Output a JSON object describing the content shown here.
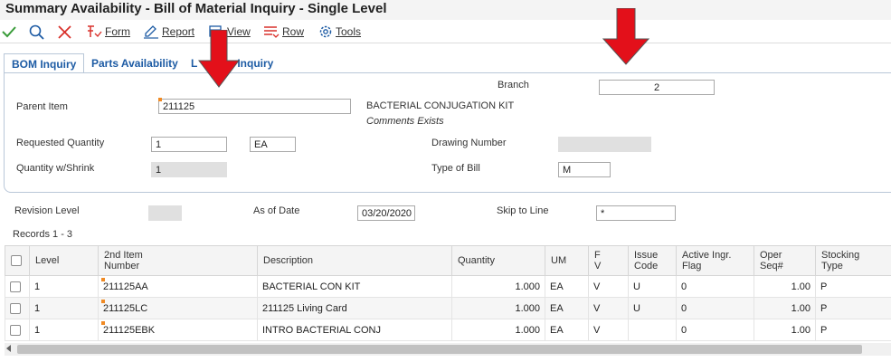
{
  "window": {
    "title": "Summary Availability - Bill of Material Inquiry - Single Level"
  },
  "toolbar": {
    "form_label": "Form",
    "report_label": "Report",
    "view_label": "View",
    "row_label": "Row",
    "tools_label": "Tools"
  },
  "tabs": {
    "bom_inquiry": "BOM Inquiry",
    "parts_availability": "Parts Availability",
    "third_partial": "L",
    "third_suffix": "Inquiry"
  },
  "header": {
    "branch_label": "Branch",
    "branch_value": "2",
    "parent_item_label": "Parent Item",
    "parent_item_value": "211125",
    "parent_item_desc": "BACTERIAL CONJUGATION KIT",
    "comments_text": "Comments Exists",
    "requested_qty_label": "Requested Quantity",
    "requested_qty_value": "1",
    "uom_value": "EA",
    "drawing_number_label": "Drawing Number",
    "drawing_number_value": "",
    "qty_shrink_label": "Quantity w/Shrink",
    "qty_shrink_value": "1",
    "type_of_bill_label": "Type of Bill",
    "type_of_bill_value": "M"
  },
  "filters": {
    "revision_level_label": "Revision Level",
    "revision_level_value": "",
    "as_of_date_label": "As of Date",
    "as_of_date_value": "03/20/2020",
    "skip_to_line_label": "Skip to Line",
    "skip_to_line_value": "*"
  },
  "grid": {
    "records_label": "Records 1 - 3",
    "columns": {
      "level": "Level",
      "second_item_l1": "2nd Item",
      "second_item_l2": "Number",
      "description": "Description",
      "quantity": "Quantity",
      "um": "UM",
      "fv_l1": "F",
      "fv_l2": "V",
      "issue_l1": "Issue",
      "issue_l2": "Code",
      "active_l1": "Active Ingr.",
      "active_l2": "Flag",
      "oper_l1": "Oper",
      "oper_l2": "Seq#",
      "stocking_l1": "Stocking",
      "stocking_l2": "Type"
    },
    "rows": [
      {
        "level": "1",
        "item": "211125AA",
        "description": "BACTERIAL CON KIT",
        "quantity": "1.000",
        "um": "EA",
        "fv": "V",
        "issue": "U",
        "active": "0",
        "oper": "1.00",
        "stocking": "P"
      },
      {
        "level": "1",
        "item": "211125LC",
        "description": "211125 Living Card",
        "quantity": "1.000",
        "um": "EA",
        "fv": "V",
        "issue": "U",
        "active": "0",
        "oper": "1.00",
        "stocking": "P"
      },
      {
        "level": "1",
        "item": "211125EBK",
        "description": "INTRO BACTERIAL CONJ",
        "quantity": "1.000",
        "um": "EA",
        "fv": "V",
        "issue": "",
        "active": "0",
        "oper": "1.00",
        "stocking": "P"
      }
    ]
  },
  "colors": {
    "accent": "#1d5ba4",
    "arrow": "#e3101a",
    "required_marker": "#f08a24",
    "ok_check": "#3a9c3a",
    "cancel_x": "#d9312b"
  }
}
